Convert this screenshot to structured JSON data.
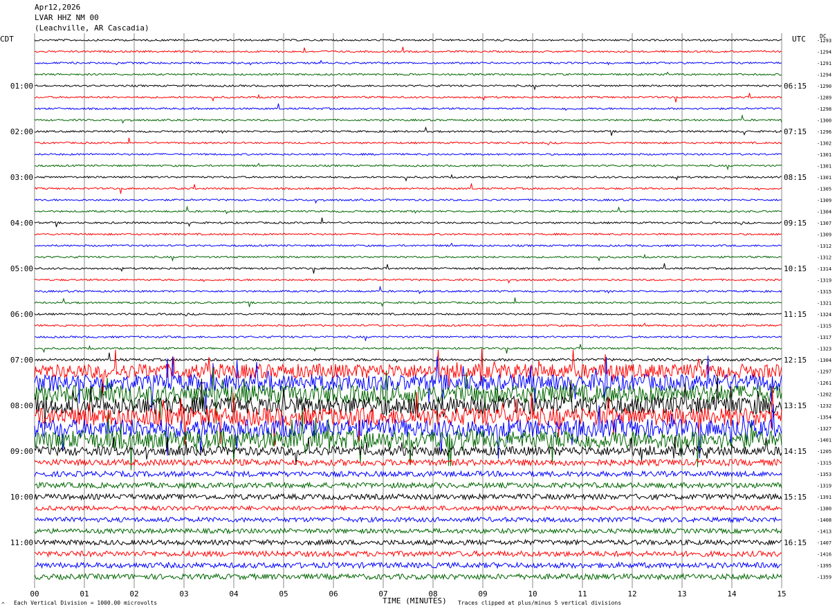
{
  "header": {
    "date": "Apr12,2026",
    "station": "LVAR HHZ NM 00",
    "location": "(Leachville, AR Cascadia)"
  },
  "left_label": "CDT",
  "right_label": "UTC",
  "dc_label": "DC",
  "footer": {
    "xlabel": "TIME (MINUTES)",
    "scale_note": "Each Vertical Division = 1000.00 microvolts",
    "clip_note": "Traces clipped at plus/minus 5 vertical divisions",
    "corner_mark": "^"
  },
  "colors": {
    "cycle": [
      "#000000",
      "#ff0000",
      "#0000ff",
      "#006600"
    ],
    "grid": "#888888"
  },
  "chart_data": {
    "type": "line",
    "x_ticks": [
      "00",
      "01",
      "02",
      "03",
      "04",
      "05",
      "06",
      "07",
      "08",
      "09",
      "10",
      "11",
      "12",
      "13",
      "14",
      "15"
    ],
    "xlim": [
      0,
      15
    ],
    "left_time_labels": [
      "01:00",
      "02:00",
      "03:00",
      "04:00",
      "05:00",
      "06:00",
      "07:00",
      "08:00",
      "09:00",
      "10:00",
      "11:00"
    ],
    "right_time_labels": [
      "06:15",
      "07:15",
      "08:15",
      "09:15",
      "10:15",
      "11:15",
      "12:15",
      "13:15",
      "14:15",
      "15:15",
      "16:15"
    ],
    "dc_offsets": [
      "-1293",
      "-1294",
      "-1291",
      "-1294",
      "-1290",
      "-1289",
      "-1298",
      "-1300",
      "-1296",
      "-1302",
      "-1301",
      "-1301",
      "-1301",
      "-1305",
      "-1309",
      "-1304",
      "-1307",
      "-1309",
      "-1312",
      "-1312",
      "-1314",
      "-1319",
      "-1315",
      "-1321",
      "-1324",
      "-1315",
      "-1317",
      "-1323",
      "-1304",
      "-1297",
      "-1261",
      "-1202",
      "-1232",
      "-1354",
      "-1327",
      "-1401",
      "-1205",
      "-1315",
      "-1353",
      "-1319",
      "-1391",
      "-1380",
      "-1408",
      "-1413",
      "-1407",
      "-1416",
      "-1395",
      "-1359"
    ],
    "trace_activity": [
      1,
      1,
      1,
      1,
      1,
      1,
      1,
      1,
      1,
      1,
      1,
      1,
      1,
      1,
      1,
      1,
      1,
      1,
      1,
      1,
      1,
      1,
      1,
      1,
      1,
      1,
      1,
      1,
      1.4,
      8,
      9,
      10,
      10,
      10,
      10,
      10,
      5,
      3.5,
      3,
      3,
      3,
      2.5,
      2.6,
      2.6,
      2.8,
      3,
      3,
      3
    ]
  }
}
